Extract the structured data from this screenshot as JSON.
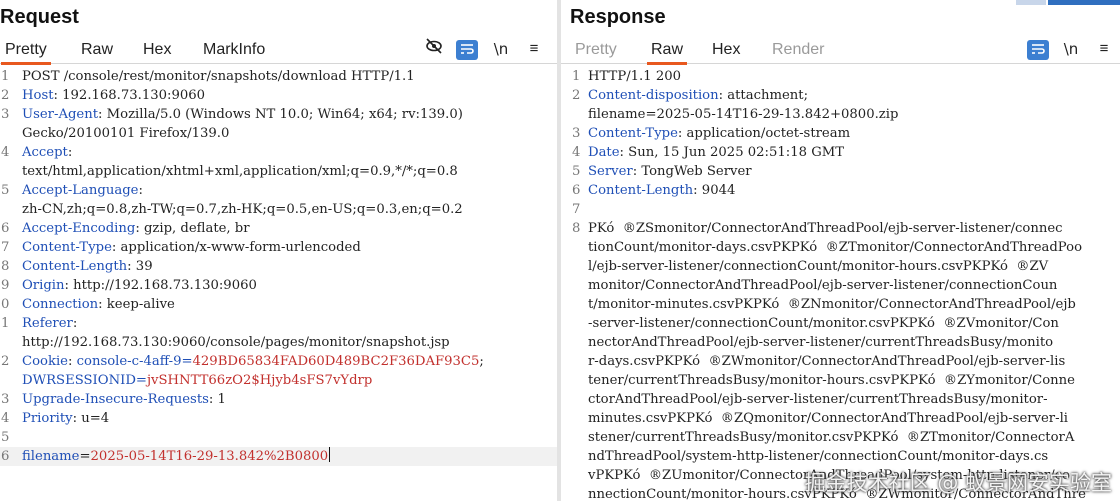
{
  "request": {
    "title": "Request",
    "tabs": [
      "Pretty",
      "Raw",
      "Hex",
      "MarkInfo"
    ],
    "active_tab": "Pretty",
    "tools": {
      "hide_icon": "eye-off-icon",
      "wrap_icon": "wrap-lines-icon",
      "newline_label": "\\n",
      "menu_icon": "≡"
    },
    "lines": [
      {
        "num": "1",
        "text": "POST /console/rest/monitor/snapshots/download HTTP/1.1"
      },
      {
        "num": "2",
        "key": "Host",
        "text": ": 192.168.73.130:9060"
      },
      {
        "num": "3",
        "key": "User-Agent",
        "text": ": Mozilla/5.0 (Windows NT 10.0; Win64; x64; rv:139.0)"
      },
      {
        "num": "",
        "text": "Gecko/20100101 Firefox/139.0"
      },
      {
        "num": "4",
        "key": "Accept",
        "text": ":"
      },
      {
        "num": "",
        "text": "text/html,application/xhtml+xml,application/xml;q=0.9,*/*;q=0.8"
      },
      {
        "num": "5",
        "key": "Accept-Language",
        "text": ":"
      },
      {
        "num": "",
        "text": "zh-CN,zh;q=0.8,zh-TW;q=0.7,zh-HK;q=0.5,en-US;q=0.3,en;q=0.2"
      },
      {
        "num": "6",
        "key": "Accept-Encoding",
        "text": ": gzip, deflate, br"
      },
      {
        "num": "7",
        "key": "Content-Type",
        "text": ": application/x-www-form-urlencoded"
      },
      {
        "num": "8",
        "key": "Content-Length",
        "text": ": 39"
      },
      {
        "num": "9",
        "key": "Origin",
        "text": ": http://192.168.73.130:9060"
      },
      {
        "num": "0",
        "key": "Connection",
        "text": ": keep-alive"
      },
      {
        "num": "1",
        "key": "Referer",
        "text": ":"
      },
      {
        "num": "",
        "text": "http://192.168.73.130:9060/console/pages/monitor/snapshot.jsp"
      },
      {
        "num": "2",
        "key": "Cookie",
        "text": ": ",
        "cookie1_name": "console-c-4aff-9",
        "cookie1_val": "429BD65834FAD60D489BC2F36DAF93C5",
        "sep": ";"
      },
      {
        "num": "",
        "cookie2_name": "DWRSESSIONID",
        "cookie2_val": "jvSHNTT66zO2$Hjyb4sFS7vYdrp"
      },
      {
        "num": "3",
        "key": "Upgrade-Insecure-Requests",
        "text": ": 1"
      },
      {
        "num": "4",
        "key": "Priority",
        "text": ": u=4"
      },
      {
        "num": "5",
        "text": ""
      },
      {
        "num": "6",
        "param_name": "filename",
        "param_val": "2025-05-14T16-29-13.842%2B0800"
      }
    ]
  },
  "response": {
    "title": "Response",
    "tabs": [
      "Pretty",
      "Raw",
      "Hex",
      "Render"
    ],
    "active_tab": "Raw",
    "tools": {
      "wrap_icon": "wrap-lines-icon",
      "newline_label": "\\n",
      "menu_icon": "≡"
    },
    "lines": [
      {
        "num": "1",
        "text": "HTTP/1.1 200"
      },
      {
        "num": "2",
        "key": "Content-disposition",
        "text": ": attachment;"
      },
      {
        "num": "",
        "text": "filename=2025-05-14T16-29-13.842+0800.zip"
      },
      {
        "num": "3",
        "key": "Content-Type",
        "text": ": application/octet-stream"
      },
      {
        "num": "4",
        "key": "Date",
        "text": ": Sun, 15 Jun 2025 02:51:18 GMT"
      },
      {
        "num": "5",
        "key": "Server",
        "text": ": TongWeb Server"
      },
      {
        "num": "6",
        "key": "Content-Length",
        "text": ": 9044"
      },
      {
        "num": "7",
        "text": ""
      },
      {
        "num": "8",
        "text": "PKó  ®ZSmonitor/ConnectorAndThreadPool/ejb-server-listener/connec"
      },
      {
        "num": "",
        "text": "tionCount/monitor-days.csvPKPKó  ®ZTmonitor/ConnectorAndThreadPoo"
      },
      {
        "num": "",
        "text": "l/ejb-server-listener/connectionCount/monitor-hours.csvPKPKó  ®ZV"
      },
      {
        "num": "",
        "text": "monitor/ConnectorAndThreadPool/ejb-server-listener/connectionCoun"
      },
      {
        "num": "",
        "text": "t/monitor-minutes.csvPKPKó  ®ZNmonitor/ConnectorAndThreadPool/ejb"
      },
      {
        "num": "",
        "text": "-server-listener/connectionCount/monitor.csvPKPKó  ®ZVmonitor/Con"
      },
      {
        "num": "",
        "text": "nectorAndThreadPool/ejb-server-listener/currentThreadsBusy/monito"
      },
      {
        "num": "",
        "text": "r-days.csvPKPKó  ®ZWmonitor/ConnectorAndThreadPool/ejb-server-lis"
      },
      {
        "num": "",
        "text": "tener/currentThreadsBusy/monitor-hours.csvPKPKó  ®ZYmonitor/Conne"
      },
      {
        "num": "",
        "text": "ctorAndThreadPool/ejb-server-listener/currentThreadsBusy/monitor-"
      },
      {
        "num": "",
        "text": "minutes.csvPKPKó  ®ZQmonitor/ConnectorAndThreadPool/ejb-server-li"
      },
      {
        "num": "",
        "text": "stener/currentThreadsBusy/monitor.csvPKPKó  ®ZTmonitor/ConnectorA"
      },
      {
        "num": "",
        "text": "ndThreadPool/system-http-listener/connectionCount/monitor-days.cs"
      },
      {
        "num": "",
        "text": "vPKPKó  ®ZUmonitor/ConnectorAndThreadPool/system-http-listener/co"
      },
      {
        "num": "",
        "text": "nnectionCount/monitor-hours.csvPKPKó  ®ZWmonitor/ConnectorAndThre"
      }
    ]
  },
  "watermark": "掘金技术社区 @ 蚁景网安实验室",
  "colors": {
    "accent": "#e8581f",
    "key": "#1f4fb6",
    "value": "#c2302d",
    "tool_blue": "#3c7fd1"
  }
}
